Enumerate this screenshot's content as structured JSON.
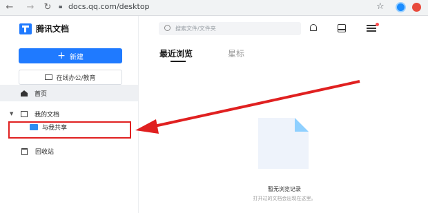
{
  "browser": {
    "url": "docs.qq.com/desktop"
  },
  "sidebar": {
    "logo_text": "腾讯文档",
    "new_button": "新建",
    "office_button": "在线办公/教育",
    "items": [
      {
        "label": "首页"
      },
      {
        "label": "我的文档"
      },
      {
        "label": "与我共享"
      },
      {
        "label": "回收站"
      }
    ]
  },
  "header": {
    "search_placeholder": "搜索文件/文件夹"
  },
  "main": {
    "tabs": [
      {
        "label": "最近浏览"
      },
      {
        "label": "星标"
      }
    ],
    "empty_title": "暂无浏览记录",
    "empty_subtitle": "打开过的文档会出现在这里。"
  },
  "colors": {
    "brand": "#1f7aff",
    "highlight": "#e02020"
  }
}
